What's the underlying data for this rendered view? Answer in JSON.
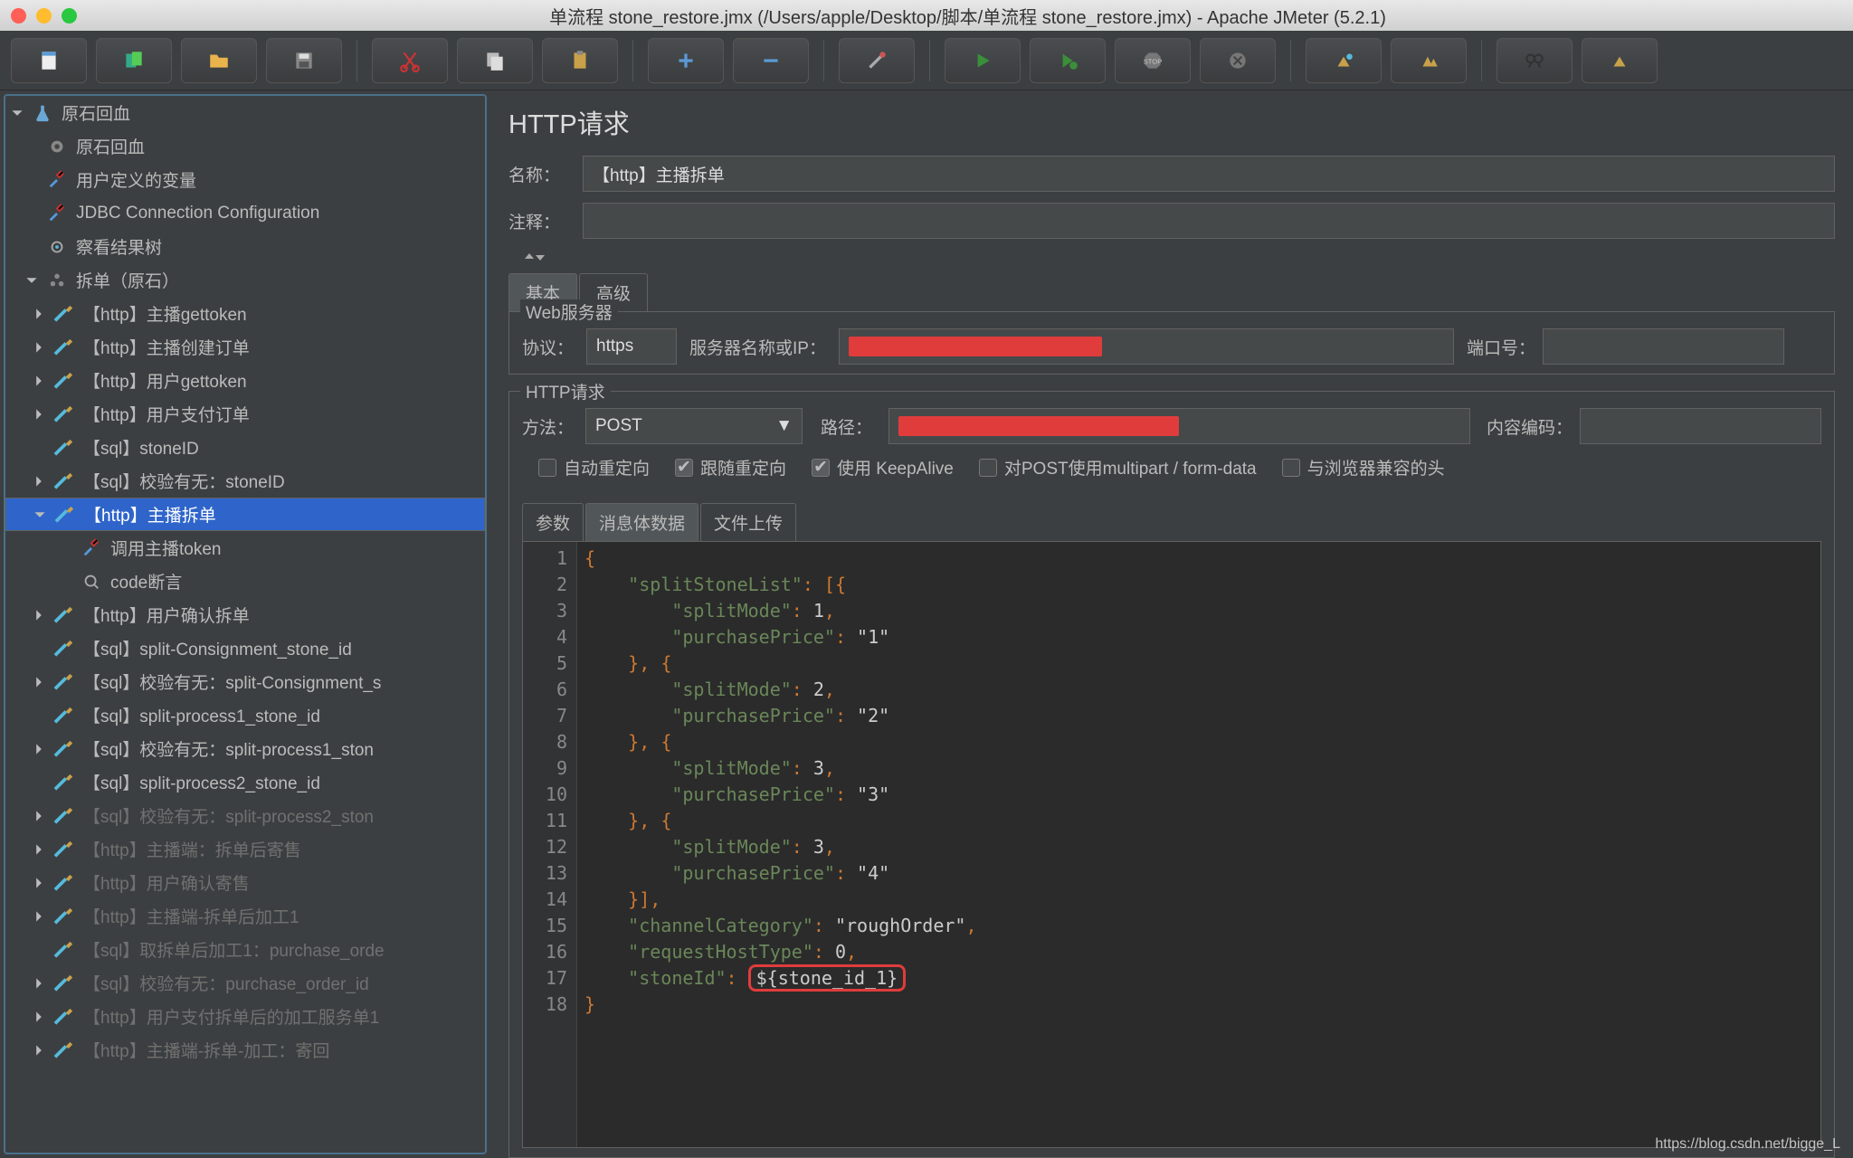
{
  "title": "单流程 stone_restore.jmx (/Users/apple/Desktop/脚本/单流程 stone_restore.jmx) - Apache JMeter (5.2.1)",
  "tree": [
    {
      "d": 1,
      "t": "原石回血",
      "tw": "▼",
      "ic": "flask"
    },
    {
      "d": 2,
      "t": "原石回血",
      "tw": "",
      "ic": "gear"
    },
    {
      "d": 2,
      "t": "用户定义的变量",
      "tw": "",
      "ic": "wrench"
    },
    {
      "d": 2,
      "t": "JDBC Connection Configuration",
      "tw": "",
      "ic": "wrench"
    },
    {
      "d": 2,
      "t": "察看结果树",
      "tw": "",
      "ic": "tree"
    },
    {
      "d": 2,
      "t": "拆单（原石）",
      "tw": "▼",
      "ic": "thread"
    },
    {
      "d": 3,
      "t": "【http】主播gettoken",
      "tw": "▶",
      "ic": "sampler"
    },
    {
      "d": 3,
      "t": "【http】主播创建订单",
      "tw": "▶",
      "ic": "sampler"
    },
    {
      "d": 3,
      "t": "【http】用户gettoken",
      "tw": "▶",
      "ic": "sampler"
    },
    {
      "d": 3,
      "t": "【http】用户支付订单",
      "tw": "▶",
      "ic": "sampler"
    },
    {
      "d": 3,
      "t": "【sql】stoneID",
      "tw": "",
      "ic": "sampler"
    },
    {
      "d": 3,
      "t": "【sql】校验有无：stoneID",
      "tw": "▶",
      "ic": "sampler"
    },
    {
      "d": 3,
      "t": "【http】主播拆单",
      "tw": "▼",
      "ic": "sampler",
      "sel": true
    },
    {
      "d": 4,
      "t": "调用主播token",
      "tw": "",
      "ic": "wrench"
    },
    {
      "d": 4,
      "t": "code断言",
      "tw": "",
      "ic": "assert"
    },
    {
      "d": 3,
      "t": "【http】用户确认拆单",
      "tw": "▶",
      "ic": "sampler"
    },
    {
      "d": 3,
      "t": "【sql】split-Consignment_stone_id",
      "tw": "",
      "ic": "sampler"
    },
    {
      "d": 3,
      "t": "【sql】校验有无：split-Consignment_s",
      "tw": "▶",
      "ic": "sampler"
    },
    {
      "d": 3,
      "t": "【sql】split-process1_stone_id",
      "tw": "",
      "ic": "sampler"
    },
    {
      "d": 3,
      "t": "【sql】校验有无：split-process1_ston",
      "tw": "▶",
      "ic": "sampler"
    },
    {
      "d": 3,
      "t": "【sql】split-process2_stone_id",
      "tw": "",
      "ic": "sampler"
    },
    {
      "d": 3,
      "t": "【sql】校验有无：split-process2_ston",
      "tw": "▶",
      "ic": "sampler",
      "dim": true
    },
    {
      "d": 3,
      "t": "【http】主播端：拆单后寄售",
      "tw": "▶",
      "ic": "sampler",
      "dim": true
    },
    {
      "d": 3,
      "t": "【http】用户确认寄售",
      "tw": "▶",
      "ic": "sampler",
      "dim": true
    },
    {
      "d": 3,
      "t": "【http】主播端-拆单后加工1",
      "tw": "▶",
      "ic": "sampler",
      "dim": true
    },
    {
      "d": 3,
      "t": "【sql】取拆单后加工1：purchase_orde",
      "tw": "",
      "ic": "sampler",
      "dim": true
    },
    {
      "d": 3,
      "t": "【sql】校验有无：purchase_order_id",
      "tw": "▶",
      "ic": "sampler",
      "dim": true
    },
    {
      "d": 3,
      "t": "【http】用户支付拆单后的加工服务单1",
      "tw": "▶",
      "ic": "sampler",
      "dim": true
    },
    {
      "d": 3,
      "t": "【http】主播端-拆单-加工：寄回",
      "tw": "▶",
      "ic": "sampler",
      "dim": true
    }
  ],
  "panel": {
    "header": "HTTP请求",
    "name_label": "名称：",
    "name_value": "【http】主播拆单",
    "comment_label": "注释：",
    "tabs": {
      "basic": "基本",
      "advanced": "高级"
    },
    "webserver": {
      "legend": "Web服务器",
      "protocol_label": "协议：",
      "protocol": "https",
      "server_label": "服务器名称或IP：",
      "port_label": "端口号："
    },
    "httpreq": {
      "legend": "HTTP请求",
      "method_label": "方法：",
      "method": "POST",
      "path_label": "路径：",
      "encoding_label": "内容编码：",
      "chk_auto": "自动重定向",
      "chk_follow": "跟随重定向",
      "chk_keepalive": "使用 KeepAlive",
      "chk_multipart": "对POST使用multipart / form-data",
      "chk_browser": "与浏览器兼容的头"
    },
    "subtabs": {
      "params": "参数",
      "body": "消息体数据",
      "files": "文件上传"
    },
    "code_lines": [
      "{",
      "    \"splitStoneList\": [{",
      "        \"splitMode\": 1,",
      "        \"purchasePrice\": \"1\"",
      "    }, {",
      "        \"splitMode\": 2,",
      "        \"purchasePrice\": \"2\"",
      "    }, {",
      "        \"splitMode\": 3,",
      "        \"purchasePrice\": \"3\"",
      "    }, {",
      "        \"splitMode\": 3,",
      "        \"purchasePrice\": \"4\"",
      "    }],",
      "    \"channelCategory\": \"roughOrder\",",
      "    \"requestHostType\": 0,",
      "    \"stoneId\": ${stone_id_1}",
      "}"
    ]
  },
  "watermark": "https://blog.csdn.net/bigge_L"
}
